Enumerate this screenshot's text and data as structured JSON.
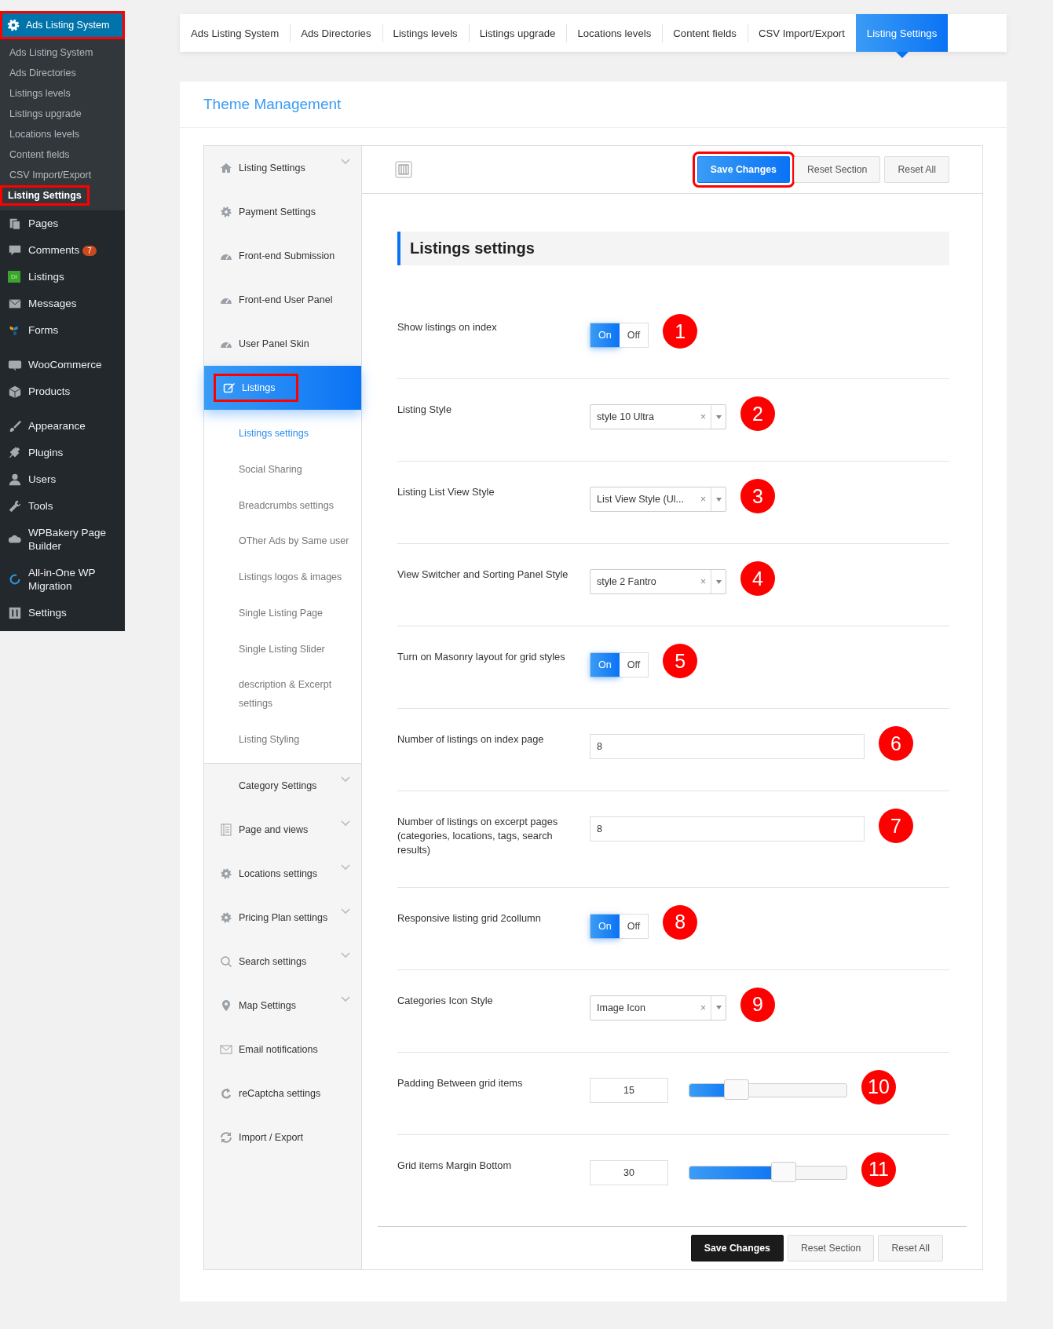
{
  "wp_menu": {
    "header": {
      "label": "Ads Listing System",
      "highlighted": true
    },
    "submenu": [
      {
        "label": "Ads Listing System",
        "selected": false,
        "highlighted": false
      },
      {
        "label": "Ads Directories",
        "selected": false,
        "highlighted": false
      },
      {
        "label": "Listings levels",
        "selected": false,
        "highlighted": false
      },
      {
        "label": "Listings upgrade",
        "selected": false,
        "highlighted": false
      },
      {
        "label": "Locations levels",
        "selected": false,
        "highlighted": false
      },
      {
        "label": "Content fields",
        "selected": false,
        "highlighted": false
      },
      {
        "label": "CSV Import/Export",
        "selected": false,
        "highlighted": false
      },
      {
        "label": "Listing Settings",
        "selected": true,
        "highlighted": true
      }
    ],
    "items": [
      {
        "label": "Pages"
      },
      {
        "label": "Comments",
        "badge": "7"
      },
      {
        "label": "Listings",
        "icon_text": "DI"
      },
      {
        "label": "Messages"
      },
      {
        "label": "Forms"
      },
      {
        "label": "WooCommerce"
      },
      {
        "label": "Products"
      },
      {
        "label": "Appearance"
      },
      {
        "label": "Plugins"
      },
      {
        "label": "Users"
      },
      {
        "label": "Tools"
      },
      {
        "label": "WPBakery Page Builder"
      },
      {
        "label": "All-in-One WP Migration"
      },
      {
        "label": "Settings"
      }
    ]
  },
  "tabs": [
    {
      "label": "Ads Listing System",
      "selected": false
    },
    {
      "label": "Ads Directories",
      "selected": false
    },
    {
      "label": "Listings levels",
      "selected": false
    },
    {
      "label": "Listings upgrade",
      "selected": false
    },
    {
      "label": "Locations levels",
      "selected": false
    },
    {
      "label": "Content fields",
      "selected": false
    },
    {
      "label": "CSV Import/Export",
      "selected": false
    },
    {
      "label": "Listing Settings",
      "selected": true
    }
  ],
  "panel_title": "Theme Management",
  "nav": [
    {
      "label": "Listing Settings",
      "expandable": true,
      "selected": false,
      "highlighted": false
    },
    {
      "label": "Payment Settings",
      "expandable": false,
      "selected": false,
      "highlighted": false
    },
    {
      "label": "Front-end Submission",
      "expandable": false,
      "selected": false,
      "highlighted": false
    },
    {
      "label": "Front-end User Panel",
      "expandable": false,
      "selected": false,
      "highlighted": false
    },
    {
      "label": "User Panel Skin",
      "expandable": false,
      "selected": false,
      "highlighted": false
    },
    {
      "label": "Listings",
      "expandable": false,
      "selected": true,
      "highlighted": true,
      "children": [
        {
          "label": "Listings settings",
          "selected": true
        },
        {
          "label": "Social Sharing",
          "selected": false
        },
        {
          "label": "Breadcrumbs settings",
          "selected": false
        },
        {
          "label": "OTher Ads by Same user",
          "selected": false
        },
        {
          "label": "Listings logos & images",
          "selected": false
        },
        {
          "label": "Single Listing Page",
          "selected": false
        },
        {
          "label": "Single Listing Slider",
          "selected": false
        },
        {
          "label": "description & Excerpt settings",
          "selected": false
        },
        {
          "label": "Listing Styling",
          "selected": false
        }
      ]
    },
    {
      "label": "Category Settings",
      "expandable": true,
      "selected": false,
      "highlighted": false
    },
    {
      "label": "Page and views",
      "expandable": true,
      "selected": false,
      "highlighted": false
    },
    {
      "label": "Locations settings",
      "expandable": true,
      "selected": false,
      "highlighted": false
    },
    {
      "label": "Pricing Plan settings",
      "expandable": true,
      "selected": false,
      "highlighted": false
    },
    {
      "label": "Search settings",
      "expandable": true,
      "selected": false,
      "highlighted": false
    },
    {
      "label": "Map Settings",
      "expandable": true,
      "selected": false,
      "highlighted": false
    },
    {
      "label": "Email notifications",
      "expandable": false,
      "selected": false,
      "highlighted": false
    },
    {
      "label": "reCaptcha settings",
      "expandable": false,
      "selected": false,
      "highlighted": false
    },
    {
      "label": "Import / Export",
      "expandable": false,
      "selected": false,
      "highlighted": false
    }
  ],
  "top_buttons": [
    {
      "label": "Save Changes",
      "kind": "primary",
      "highlighted": true
    },
    {
      "label": "Reset Section",
      "kind": "plain",
      "highlighted": false
    },
    {
      "label": "Reset All",
      "kind": "plain",
      "highlighted": false
    }
  ],
  "section_title": "Listings settings",
  "settings": [
    {
      "kind": "toggle",
      "label": "Show listings on index",
      "on_label": "On",
      "off_label": "Off",
      "on": true,
      "marker": "1"
    },
    {
      "kind": "select",
      "label": "Listing Style",
      "value": "style 10 Ultra",
      "clear": "×",
      "marker": "2"
    },
    {
      "kind": "select",
      "label": "Listing List View Style",
      "value": "List View Style (Ul...",
      "clear": "×",
      "marker": "3"
    },
    {
      "kind": "select",
      "label": "View Switcher and Sorting Panel Style",
      "value": "style 2 Fantro",
      "clear": "×",
      "marker": "4"
    },
    {
      "kind": "toggle",
      "label": "Turn on Masonry layout for grid styles",
      "on_label": "On",
      "off_label": "Off",
      "on": true,
      "marker": "5"
    },
    {
      "kind": "text",
      "label": "Number of listings on index page",
      "value": "8",
      "marker": "6"
    },
    {
      "kind": "text",
      "label": "Number of listings on excerpt pages (categories, locations, tags, search results)",
      "value": "8",
      "marker": "7"
    },
    {
      "kind": "toggle",
      "label": "Responsive listing grid 2collumn",
      "on_label": "On",
      "off_label": "Off",
      "on": true,
      "marker": "8"
    },
    {
      "kind": "select",
      "label": "Categories Icon Style",
      "value": "Image Icon",
      "clear": "×",
      "marker": "9"
    },
    {
      "kind": "slider",
      "label": "Padding Between grid items",
      "value": "15",
      "level": 0.3,
      "marker": "10"
    },
    {
      "kind": "slider",
      "label": "Grid items Margin Bottom",
      "value": "30",
      "level": 0.6,
      "marker": "11"
    }
  ],
  "bottom_buttons": [
    {
      "label": "Save Changes",
      "kind": "dark",
      "highlighted": false
    },
    {
      "label": "Reset Section",
      "kind": "plain",
      "highlighted": false
    },
    {
      "label": "Reset All",
      "kind": "plain",
      "highlighted": false
    }
  ]
}
